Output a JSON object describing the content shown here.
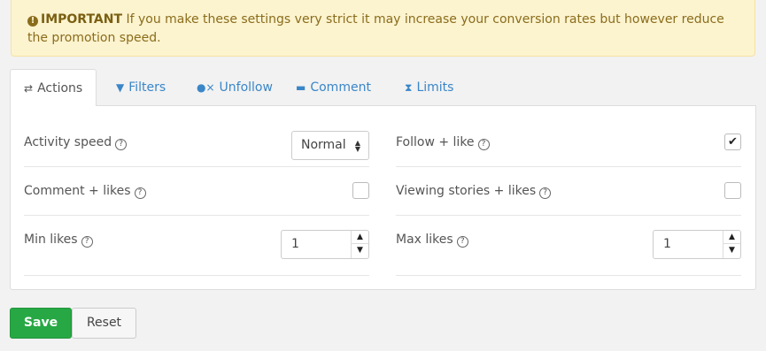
{
  "alert": {
    "icon": "exclamation-circle-icon",
    "strong": "IMPORTANT",
    "text": " If you make these settings very strict it may increase your conversion rates but however reduce the promotion speed."
  },
  "tabs": [
    {
      "label": "Actions",
      "icon": "exchange-icon",
      "active": true
    },
    {
      "label": "Filters",
      "icon": "filter-icon"
    },
    {
      "label": "Unfollow",
      "icon": "user-times-icon"
    },
    {
      "label": "Comment",
      "icon": "comment-icon"
    },
    {
      "label": "Limits",
      "icon": "hourglass-icon"
    }
  ],
  "settings": {
    "activity_speed": {
      "label": "Activity speed",
      "value": "Normal"
    },
    "follow_like": {
      "label": "Follow + like",
      "checked": true
    },
    "comment_likes": {
      "label": "Comment + likes",
      "checked": false
    },
    "viewing_stories": {
      "label": "Viewing stories + likes",
      "checked": false
    },
    "min_likes": {
      "label": "Min likes",
      "value": "1"
    },
    "max_likes": {
      "label": "Max likes",
      "value": "1"
    }
  },
  "glyphs": {
    "help": "?",
    "check": "✔",
    "up": "▲",
    "down": "▼"
  },
  "buttons": {
    "save": "Save",
    "reset": "Reset"
  },
  "colors": {
    "accent": "#3a86c8",
    "save": "#27a844",
    "alert_bg": "#fcf3cf",
    "alert_text": "#8a6d1c"
  }
}
